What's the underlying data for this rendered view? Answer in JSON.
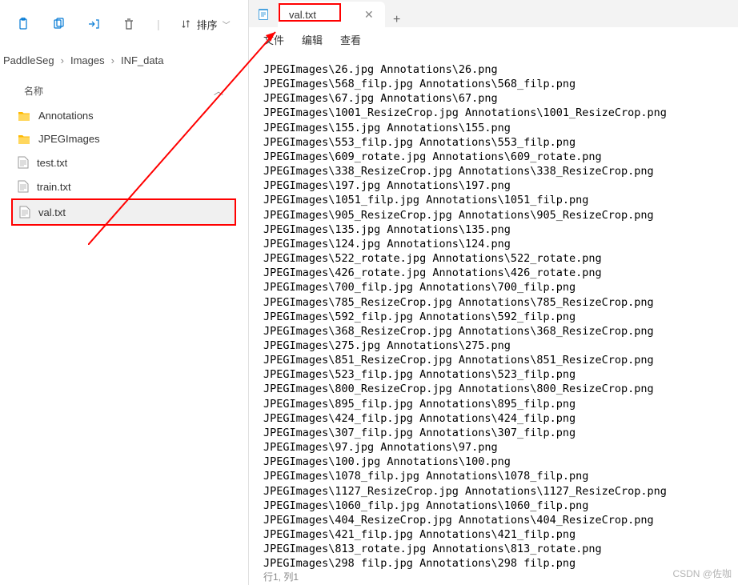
{
  "toolbar": {
    "sort_label": "排序"
  },
  "breadcrumb": {
    "parts": [
      "PaddleSeg",
      "Images",
      "INF_data"
    ]
  },
  "file_list": {
    "header": "名称",
    "items": [
      {
        "label": "Annotations",
        "type": "folder"
      },
      {
        "label": "JPEGImages",
        "type": "folder"
      },
      {
        "label": "test.txt",
        "type": "file"
      },
      {
        "label": "train.txt",
        "type": "file"
      },
      {
        "label": "val.txt",
        "type": "file",
        "selected": true
      }
    ]
  },
  "editor": {
    "tab_title": "val.txt",
    "menus": [
      "文件",
      "编辑",
      "查看"
    ],
    "status": "行1, 列1",
    "lines": [
      "JPEGImages\\26.jpg Annotations\\26.png",
      "JPEGImages\\568_filp.jpg Annotations\\568_filp.png",
      "JPEGImages\\67.jpg Annotations\\67.png",
      "JPEGImages\\1001_ResizeCrop.jpg Annotations\\1001_ResizeCrop.png",
      "JPEGImages\\155.jpg Annotations\\155.png",
      "JPEGImages\\553_filp.jpg Annotations\\553_filp.png",
      "JPEGImages\\609_rotate.jpg Annotations\\609_rotate.png",
      "JPEGImages\\338_ResizeCrop.jpg Annotations\\338_ResizeCrop.png",
      "JPEGImages\\197.jpg Annotations\\197.png",
      "JPEGImages\\1051_filp.jpg Annotations\\1051_filp.png",
      "JPEGImages\\905_ResizeCrop.jpg Annotations\\905_ResizeCrop.png",
      "JPEGImages\\135.jpg Annotations\\135.png",
      "JPEGImages\\124.jpg Annotations\\124.png",
      "JPEGImages\\522_rotate.jpg Annotations\\522_rotate.png",
      "JPEGImages\\426_rotate.jpg Annotations\\426_rotate.png",
      "JPEGImages\\700_filp.jpg Annotations\\700_filp.png",
      "JPEGImages\\785_ResizeCrop.jpg Annotations\\785_ResizeCrop.png",
      "JPEGImages\\592_filp.jpg Annotations\\592_filp.png",
      "JPEGImages\\368_ResizeCrop.jpg Annotations\\368_ResizeCrop.png",
      "JPEGImages\\275.jpg Annotations\\275.png",
      "JPEGImages\\851_ResizeCrop.jpg Annotations\\851_ResizeCrop.png",
      "JPEGImages\\523_filp.jpg Annotations\\523_filp.png",
      "JPEGImages\\800_ResizeCrop.jpg Annotations\\800_ResizeCrop.png",
      "JPEGImages\\895_filp.jpg Annotations\\895_filp.png",
      "JPEGImages\\424_filp.jpg Annotations\\424_filp.png",
      "JPEGImages\\307_filp.jpg Annotations\\307_filp.png",
      "JPEGImages\\97.jpg Annotations\\97.png",
      "JPEGImages\\100.jpg Annotations\\100.png",
      "JPEGImages\\1078_filp.jpg Annotations\\1078_filp.png",
      "JPEGImages\\1127_ResizeCrop.jpg Annotations\\1127_ResizeCrop.png",
      "JPEGImages\\1060_filp.jpg Annotations\\1060_filp.png",
      "JPEGImages\\404_ResizeCrop.jpg Annotations\\404_ResizeCrop.png",
      "JPEGImages\\421_filp.jpg Annotations\\421_filp.png",
      "JPEGImages\\813_rotate.jpg Annotations\\813_rotate.png",
      "JPEGImages\\298 filp.jpg Annotations\\298 filp.png"
    ]
  },
  "watermark": "CSDN @佐咖"
}
